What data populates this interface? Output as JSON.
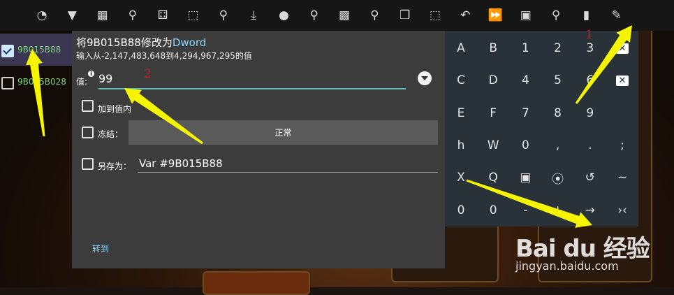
{
  "toolbar": {
    "icons": [
      "speedometer-icon",
      "filter-icon",
      "calculator-icon",
      "search-star-icon",
      "dice-icon",
      "select-area-icon",
      "scan-check-icon",
      "download-icon",
      "record-dot-icon",
      "search-text-icon",
      "chip-icon",
      "hash-search-icon",
      "copy-icon",
      "select-all-icon",
      "undo-icon",
      "fast-forward-icon",
      "save-icon",
      "help-search-icon",
      "trash-icon",
      "edit-chat-icon"
    ]
  },
  "list": {
    "items": [
      {
        "address": "9B015B88",
        "checked": true
      },
      {
        "address": "9B015B028",
        "checked": false
      }
    ]
  },
  "dialog": {
    "title_prefix": "将9B015B88修改为",
    "title_type": "Dword",
    "subtitle": "输入从-2,147,483,648到4,294,967,295的值",
    "value_label": "值:",
    "value": "99",
    "add_to_value_label": "加到值内",
    "freeze_label": "冻结：",
    "freeze_mode": "正常",
    "save_as_label": "另存为：",
    "save_as_value": "Var #9B015B88",
    "goto_label": "转到"
  },
  "keyboard": {
    "rows": [
      [
        "A",
        "B",
        "1",
        "2",
        "3",
        "⌫"
      ],
      [
        "C",
        "D",
        "4",
        "5",
        "6",
        "⌫"
      ],
      [
        "E",
        "F",
        "7",
        "8",
        "9",
        ""
      ],
      [
        "h",
        "W",
        "0",
        ",",
        ".",
        ";"
      ],
      [
        "X",
        "Q",
        "▣",
        "⦿",
        "↺",
        "~"
      ],
      [
        "0",
        "0",
        "-",
        "+",
        "→",
        "›‹"
      ]
    ]
  },
  "annotations": {
    "step1": "1",
    "step2": "2",
    "arrow_color": "#f5f500"
  },
  "watermark": {
    "main": "Bai du 经验",
    "sub": "jingyan.baidu.com"
  }
}
